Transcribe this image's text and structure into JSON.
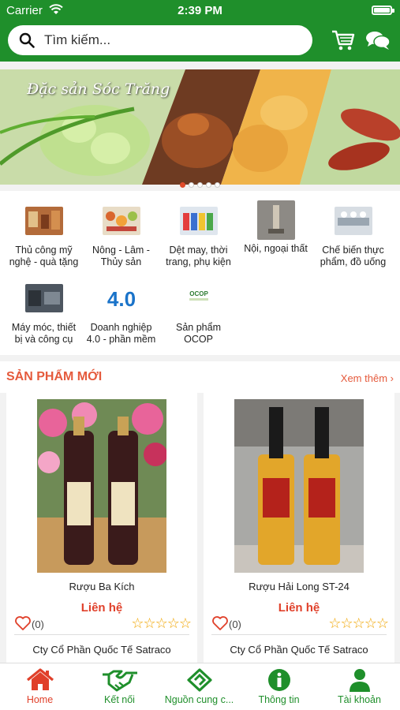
{
  "status_bar": {
    "carrier": "Carrier",
    "time": "2:39 PM"
  },
  "search": {
    "placeholder": "Tìm kiếm..."
  },
  "banner": {
    "title": "Đặc sản Sóc Trăng",
    "slide_count": 5,
    "active_slide": 1
  },
  "categories": [
    {
      "label": "Thủ công mỹ nghệ - quà tặng"
    },
    {
      "label": "Nông - Lâm - Thủy sản"
    },
    {
      "label": "Dệt may, thời trang, phụ kiện"
    },
    {
      "label": "Nội, ngoại thất"
    },
    {
      "label": "Chế biến thực phẩm, đồ uống"
    },
    {
      "label": "Máy móc, thiết bị và công cụ"
    },
    {
      "label": "Doanh nghiệp 4.0 - phần mềm",
      "logo_text": "4.0"
    },
    {
      "label": "Sản phẩm OCOP",
      "logo_text": "OCOP"
    }
  ],
  "new_products": {
    "title": "SẢN PHẨM MỚI",
    "see_more": "Xem thêm",
    "items": [
      {
        "name": "Rượu Ba Kích",
        "price": "Liên hệ",
        "likes": "(0)",
        "rating": 0,
        "seller": "Cty Cổ Phần Quốc Tế Satraco"
      },
      {
        "name": "Rượu Hải Long ST-24",
        "price": "Liên hệ",
        "likes": "(0)",
        "rating": 0,
        "seller": "Cty Cổ Phần Quốc Tế Satraco"
      }
    ]
  },
  "tabs": [
    {
      "label": "Home",
      "icon": "home-icon",
      "active": true
    },
    {
      "label": "Kết nối",
      "icon": "handshake-icon"
    },
    {
      "label": "Nguồn cung c...",
      "icon": "supply-icon"
    },
    {
      "label": "Thông tin",
      "icon": "info-icon"
    },
    {
      "label": "Tài khoản",
      "icon": "account-icon"
    }
  ],
  "colors": {
    "primary_green": "#1f8f2b",
    "accent_red": "#e0402a",
    "section_orange": "#e55a3c",
    "star": "#f0a500"
  }
}
